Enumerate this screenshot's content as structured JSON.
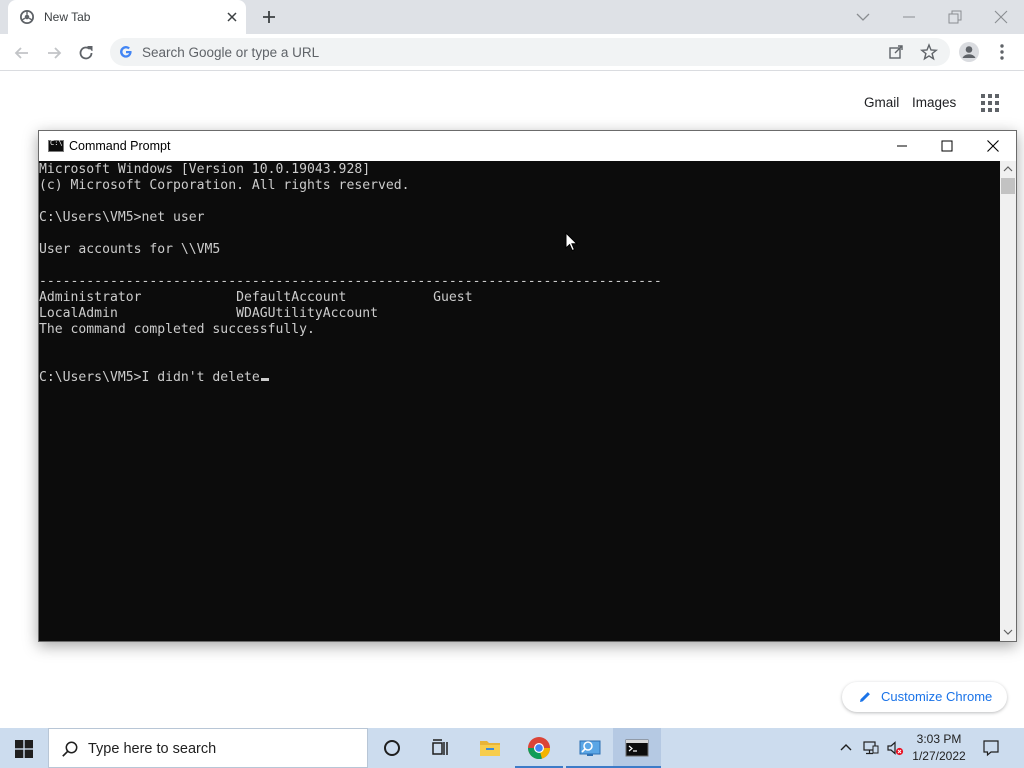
{
  "browser": {
    "tab_title": "New Tab",
    "omnibox_placeholder": "Search Google or type a URL",
    "ntp_links": {
      "gmail": "Gmail",
      "images": "Images"
    },
    "customize_label": "Customize Chrome",
    "icons": [
      "chrome-icon",
      "close-icon",
      "plus-icon",
      "chevron-down-icon",
      "minimize-icon",
      "restore-icon",
      "back-icon",
      "forward-icon",
      "reload-icon",
      "google-g-icon",
      "share-icon",
      "star-icon",
      "profile-icon",
      "kebab-menu-icon",
      "apps-grid-icon",
      "pencil-icon"
    ]
  },
  "cmd": {
    "title": "Command Prompt",
    "icon_label": "C:\\",
    "lines": [
      "Microsoft Windows [Version 10.0.19043.928]",
      "(c) Microsoft Corporation. All rights reserved.",
      "",
      "C:\\Users\\VM5>net user",
      "",
      "User accounts for \\\\VM5",
      "",
      "-------------------------------------------------------------------------------",
      "Administrator            DefaultAccount           Guest",
      "LocalAdmin               WDAGUtilityAccount",
      "The command completed successfully.",
      "",
      "",
      "C:\\Users\\VM5>I didn't delete"
    ],
    "colors": {
      "background": "#0c0c0c",
      "text": "#cccccc"
    }
  },
  "taskbar": {
    "search_placeholder": "Type here to search",
    "time": "3:03 PM",
    "date": "1/27/2022",
    "apps": [
      "cortana-icon",
      "task-view-icon",
      "file-explorer-icon",
      "chrome-icon",
      "magnifier-app-icon",
      "command-prompt-icon"
    ],
    "active_app": "command-prompt-icon",
    "colors": {
      "bar": "#ccdcee",
      "accent": "#3d7bc7"
    }
  }
}
